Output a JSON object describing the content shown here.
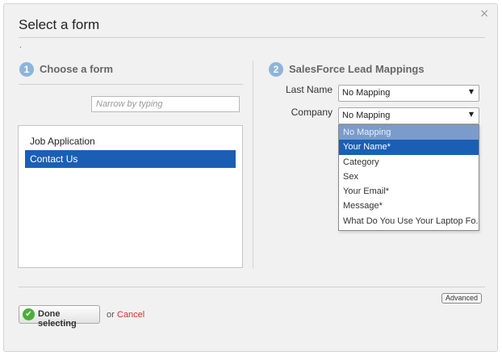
{
  "dialog": {
    "title": "Select a form",
    "close_glyph": "×",
    "dot": "."
  },
  "step1": {
    "number": "1",
    "title": "Choose a form",
    "search_placeholder": "Narrow by typing",
    "forms": [
      "Job Application",
      "Contact Us"
    ],
    "selected_index": 1
  },
  "step2": {
    "number": "2",
    "title": "SalesForce Lead Mappings",
    "mappings": [
      {
        "label": "Last Name",
        "value": "No Mapping"
      },
      {
        "label": "Company",
        "value": "No Mapping"
      }
    ],
    "dropdown_options": [
      "No Mapping",
      "Your Name*",
      "Category",
      "Sex",
      "Your Email*",
      "Message*",
      "What Do You Use Your Laptop Fo..."
    ],
    "highlighted_option": "Your Name*"
  },
  "footer": {
    "advanced_label": "Advanced",
    "done_label": "Done selecting",
    "or_text": "or",
    "cancel_label": "Cancel"
  },
  "colors": {
    "selection": "#1a5fb4",
    "step_badge": "#8fb4d9",
    "cancel": "#d23030",
    "check": "#4caf3a"
  },
  "icons": {
    "close": "close-icon",
    "dropdown_arrow": "triangle-down-icon",
    "done": "check-circle-icon"
  }
}
